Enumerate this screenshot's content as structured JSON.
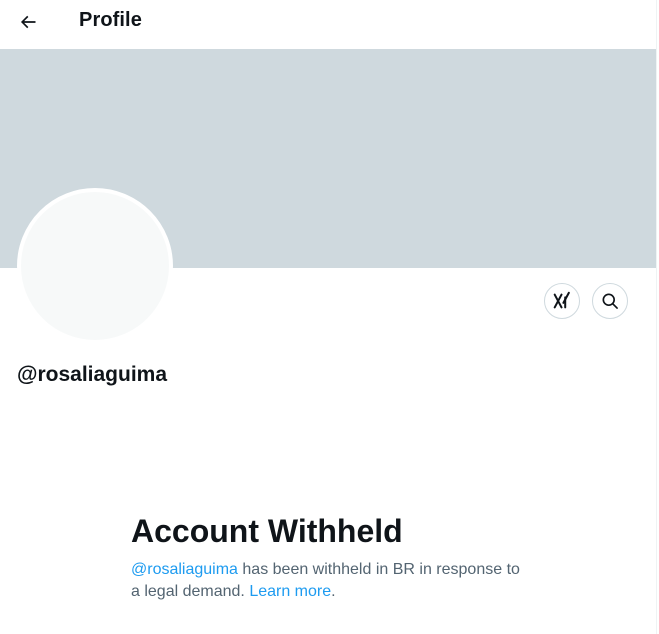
{
  "header": {
    "title": "Profile",
    "back_icon": "arrow-left-icon"
  },
  "profile": {
    "handle": "@rosaliaguima",
    "banner_color": "#cfd9de",
    "avatar_color": "#f7f9f9"
  },
  "actions": {
    "grok_icon": "grok-icon",
    "search_icon": "search-icon"
  },
  "withheld": {
    "title": "Account Withheld",
    "handle_link": "@rosaliaguima",
    "message_part1": " has been withheld in BR in response to a legal demand. ",
    "learn_more": "Learn more",
    "period": "."
  },
  "colors": {
    "link": "#1d9bf0",
    "secondary_text": "#536471",
    "primary_text": "#0f1419"
  }
}
